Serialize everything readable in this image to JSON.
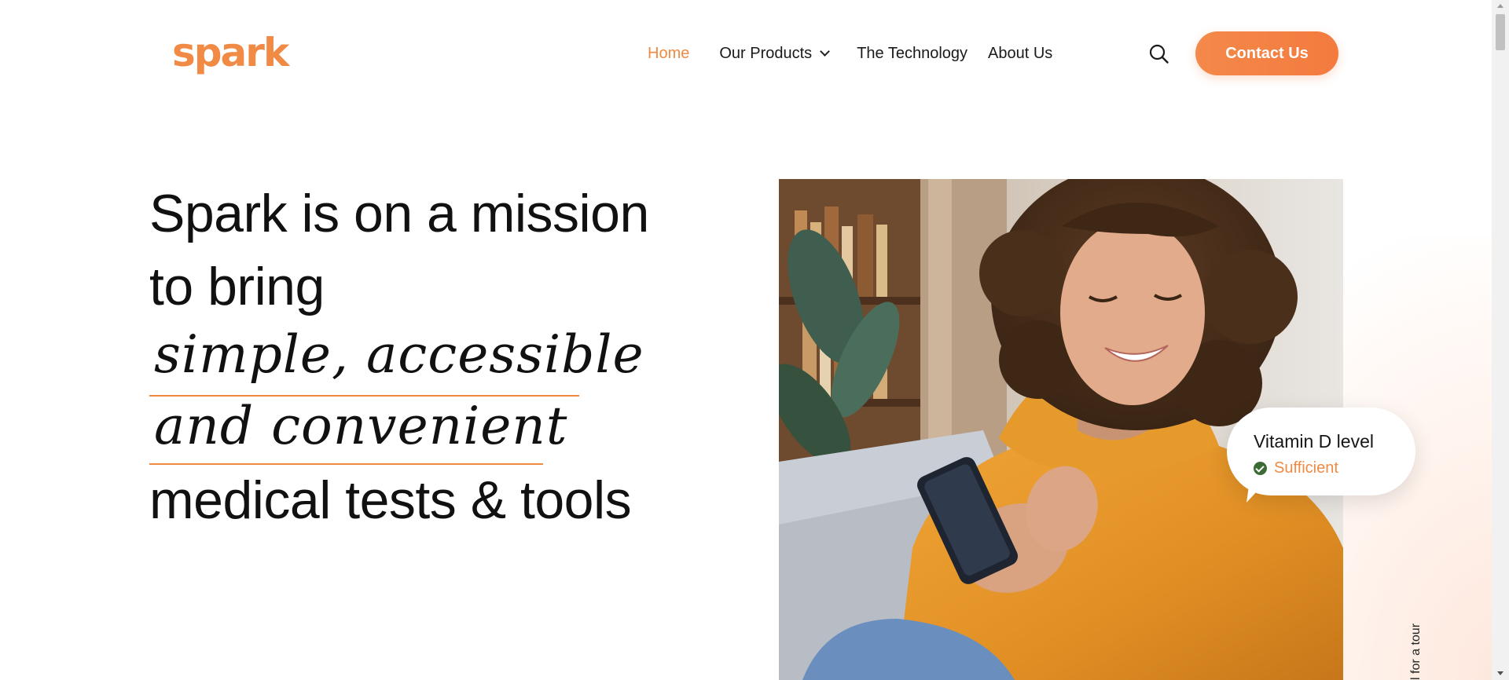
{
  "brand": {
    "name": "spark",
    "accent_color": "#ef8a44",
    "button_color": "#f47a3e"
  },
  "nav": {
    "items": [
      {
        "label": "Home",
        "active": true
      },
      {
        "label": "Our Products",
        "has_dropdown": true
      },
      {
        "label": "The Technology"
      },
      {
        "label": "About Us"
      }
    ],
    "search_icon": "search-icon",
    "contact_label": "Contact Us"
  },
  "hero": {
    "line1": "Spark is on a mission",
    "line2": "to bring",
    "highlight1": "simple, accessible",
    "highlight2": "and convenient",
    "line5": "medical tests & tools"
  },
  "vitamin_card": {
    "title": "Vitamin D level",
    "status": "Sufficient",
    "status_icon": "check-circle-icon",
    "status_icon_color": "#3d6b35"
  },
  "tour_cta": "l for a tour"
}
